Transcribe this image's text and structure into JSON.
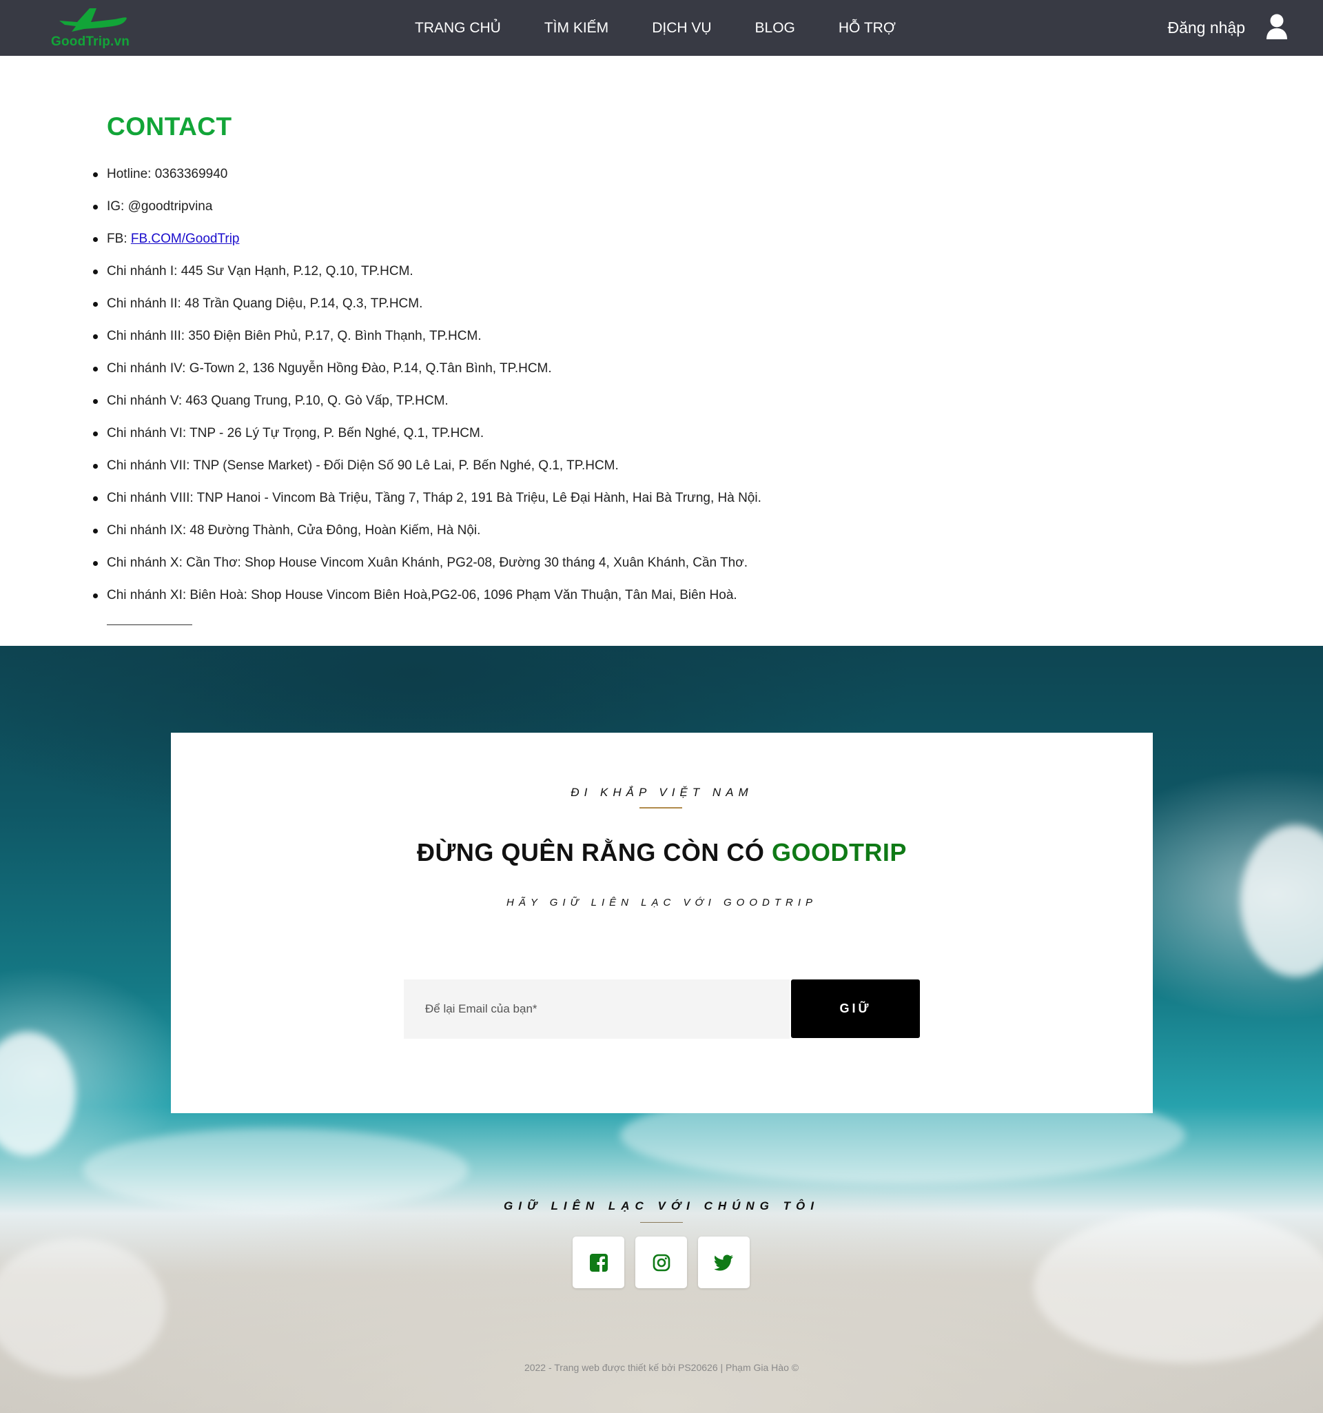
{
  "brand": {
    "logo_text": "GoodTrip.vn",
    "accent_color": "#12a538",
    "nav_bg": "#383a44"
  },
  "nav": {
    "links": [
      "TRANG CHỦ",
      "TÌM KIẾM",
      "DỊCH VỤ",
      "BLOG",
      "HỖ TRỢ"
    ],
    "login_label": "Đăng nhập",
    "user_icon": "user-icon"
  },
  "contact": {
    "title": "CONTACT",
    "items": [
      "Hotline: 0363369940",
      "IG: @goodtripvina",
      "FB: ",
      "Chi nhánh I: 445 Sư Vạn Hạnh, P.12, Q.10, TP.HCM.",
      "Chi nhánh II: 48 Trần Quang Diệu, P.14, Q.3, TP.HCM.",
      "Chi nhánh III: 350 Điện Biên Phủ, P.17, Q. Bình Thạnh, TP.HCM.",
      "Chi nhánh IV: G-Town 2, 136 Nguyễn Hồng Đào, P.14, Q.Tân Bình, TP.HCM.",
      "Chi nhánh V: 463 Quang Trung, P.10, Q. Gò Vấp, TP.HCM.",
      "Chi nhánh VI: TNP - 26 Lý Tự Trọng, P. Bến Nghé, Q.1, TP.HCM.",
      "Chi nhánh VII: TNP (Sense Market) - Đối Diện Số 90 Lê Lai, P. Bến Nghé, Q.1, TP.HCM.",
      "Chi nhánh VIII: TNP Hanoi - Vincom Bà Triệu, Tầng 7, Tháp 2, 191 Bà Triệu, Lê Đại Hành, Hai Bà Trưng, Hà Nội.",
      "Chi nhánh IX: 48 Đường Thành, Cửa Đông, Hoàn Kiếm, Hà Nội.",
      "Chi nhánh X: Cần Thơ: Shop House Vincom Xuân Khánh, PG2-08, Đường 30 tháng 4, Xuân Khánh, Cần Thơ.",
      "Chi nhánh XI: Biên Hoà: Shop House Vincom Biên Hoà,PG2-06, 1096 Phạm Văn Thuận, Tân Mai, Biên Hoà."
    ],
    "fb_link": "FB.COM/GoodTrip"
  },
  "newsletter": {
    "kicker": "ĐI KHẮP VIỆT NAM",
    "title_prefix": "ĐỪNG QUÊN RẰNG CÒN CÓ ",
    "title_brand": "GOODTRIP",
    "subtitle": "HÃY GIỮ LIÊN LẠC VỚI GOODTRIP",
    "email_placeholder": "Để lại Email của bạn*",
    "submit_label": "GIỮ",
    "brand_color": "#0f7a16"
  },
  "social": {
    "kicker": "GIỮ LIÊN LẠC VỚI CHÚNG TÔI",
    "icons": [
      "facebook-icon",
      "instagram-icon",
      "twitter-icon"
    ],
    "icon_color": "#0f7a16"
  },
  "footer": {
    "copyright": "2022 - Trang web được thiết kế bởi PS20626 | Phạm Gia Hào ©"
  }
}
